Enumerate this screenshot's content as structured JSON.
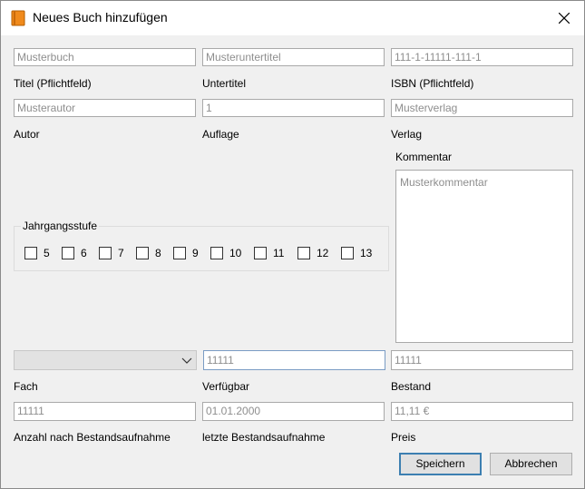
{
  "window": {
    "title": "Neues Buch hinzufügen"
  },
  "fields": {
    "titel": {
      "placeholder": "Musterbuch",
      "label": "Titel (Pflichtfeld)"
    },
    "untertitel": {
      "placeholder": "Musteruntertitel",
      "label": "Untertitel"
    },
    "isbn": {
      "placeholder": "111-1-11111-111-1",
      "label": "ISBN (Pflichtfeld)"
    },
    "autor": {
      "placeholder": "Musterautor",
      "label": "Autor"
    },
    "auflage": {
      "placeholder": "1",
      "label": "Auflage"
    },
    "verlag": {
      "placeholder": "Musterverlag",
      "label": "Verlag"
    },
    "kommentar": {
      "placeholder": "Musterkommentar",
      "label": "Kommentar"
    },
    "fach": {
      "value": "",
      "label": "Fach"
    },
    "verfuegbar": {
      "placeholder": "11111",
      "label": "Verfügbar"
    },
    "bestand": {
      "placeholder": "11111",
      "label": "Bestand"
    },
    "anzahl": {
      "placeholder": "11111",
      "label": "Anzahl nach Bestandsaufnahme"
    },
    "letzte": {
      "placeholder": "01.01.2000",
      "label": "letzte Bestandsaufnahme"
    },
    "preis": {
      "placeholder": "11,11 €",
      "label": "Preis"
    }
  },
  "jahrgangsstufe": {
    "title": "Jahrgangsstufe",
    "options": [
      "5",
      "6",
      "7",
      "8",
      "9",
      "10",
      "11",
      "12",
      "13"
    ]
  },
  "buttons": {
    "save": "Speichern",
    "cancel": "Abbrechen"
  }
}
